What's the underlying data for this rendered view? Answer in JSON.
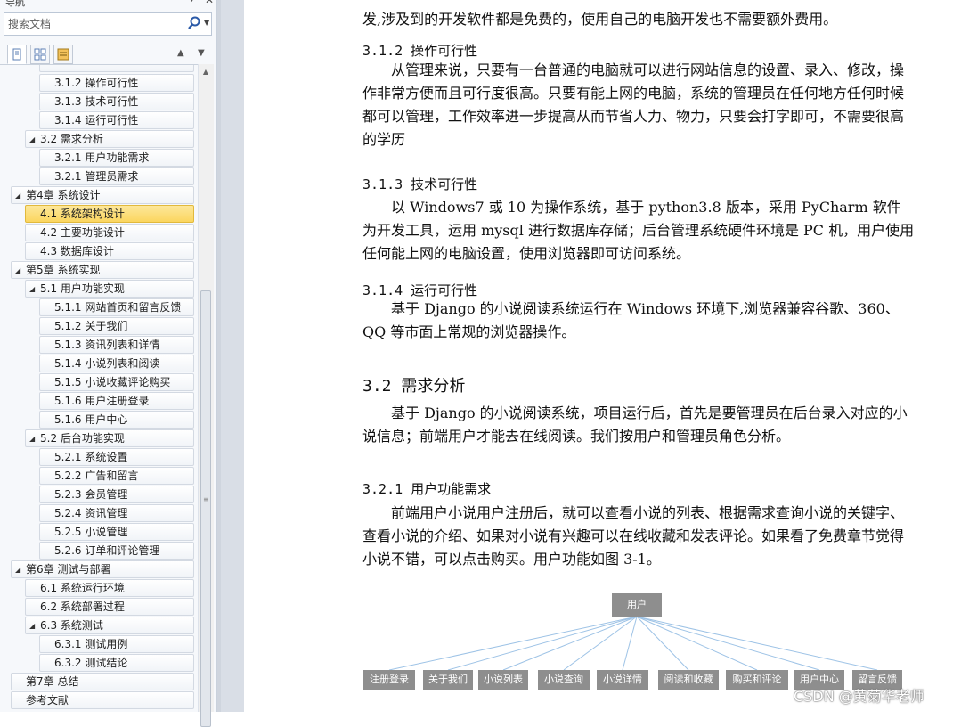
{
  "nav": {
    "title": "导航",
    "search_placeholder": "搜索文档",
    "tree": [
      {
        "label": "3.1.2  操作可行性"
      },
      {
        "label": "3.1.3  技术可行性"
      },
      {
        "label": "3.1.4  运行可行性"
      },
      {
        "label": "3.2  需求分析"
      },
      {
        "label": "3.2.1  用户功能需求"
      },
      {
        "label": "3.2.1  管理员需求"
      },
      {
        "label": "第4章  系统设计"
      },
      {
        "label": "4.1  系统架构设计"
      },
      {
        "label": "4.2  主要功能设计"
      },
      {
        "label": "4.3  数据库设计"
      },
      {
        "label": "第5章  系统实现"
      },
      {
        "label": "5.1  用户功能实现"
      },
      {
        "label": "5.1.1 网站首页和留言反馈"
      },
      {
        "label": "5.1.2 关于我们"
      },
      {
        "label": "5.1.3 资讯列表和详情"
      },
      {
        "label": "5.1.4 小说列表和阅读"
      },
      {
        "label": "5.1.5 小说收藏评论购买"
      },
      {
        "label": "5.1.6 用户注册登录"
      },
      {
        "label": "5.1.6 用户中心"
      },
      {
        "label": "5.2  后台功能实现"
      },
      {
        "label": "5.2.1  系统设置"
      },
      {
        "label": "5.2.2  广告和留言"
      },
      {
        "label": "5.2.3  会员管理"
      },
      {
        "label": "5.2.4  资讯管理"
      },
      {
        "label": "5.2.5  小说管理"
      },
      {
        "label": "5.2.6  订单和评论管理"
      },
      {
        "label": "第6章  测试与部署"
      },
      {
        "label": "6.1  系统运行环境"
      },
      {
        "label": "6.2  系统部署过程"
      },
      {
        "label": "6.3  系统测试"
      },
      {
        "label": "6.3.1  测试用例"
      },
      {
        "label": "6.3.2  测试结论"
      },
      {
        "label": "第7章  总结"
      },
      {
        "label": "参考文献"
      }
    ]
  },
  "doc": {
    "p_top": "发,涉及到的开发软件都是免费的，使用自己的电脑开发也不需要额外费用。",
    "h_312": "3.1.2  操作可行性",
    "p_312": "从管理来说，只要有一台普通的电脑就可以进行网站信息的设置、录入、修改，操作非常方便而且可行度很高。只要有能上网的电脑，系统的管理员在任何地方任何时候都可以管理，工作效率进一步提高从而节省人力、物力，只要会打字即可，不需要很高的学历",
    "h_313": "3.1.3  技术可行性",
    "p_313": "以 Windows7 或 10 为操作系统，基于 python3.8 版本，采用 PyCharm 软件为开发工具，运用 mysql 进行数据库存储；后台管理系统硬件环境是 PC 机，用户使用任何能上网的电脑设置，使用浏览器即可访问系统。",
    "h_314": "3.1.4  运行可行性",
    "p_314": "基于 Django 的小说阅读系统运行在 Windows 环境下,浏览器兼容谷歌、360、QQ 等市面上常规的浏览器操作。",
    "h_32": "3.2  需求分析",
    "p_32": "基于 Django 的小说阅读系统，项目运行后，首先是要管理员在后台录入对应的小说信息；前端用户才能去在线阅读。我们按用户和管理员角色分析。",
    "h_321": "3.2.1  用户功能需求",
    "p_321": "前端用户小说用户注册后，就可以查看小说的列表、根据需求查询小说的关键字、查看小说的介绍、如果对小说有兴趣可以在线收藏和发表评论。如果看了免费章节觉得小说不错，可以点击购买。用户功能如图 3-1。",
    "diagram": {
      "root": "用户",
      "children": [
        "注册登录",
        "关于我们",
        "小说列表",
        "小说查询",
        "小说详情",
        "阅读和收藏",
        "购买和评论",
        "用户中心",
        "留言反馈"
      ]
    }
  },
  "watermark": "CSDN @黄菊华老师",
  "colors": {
    "selected": "#fbd65f",
    "diagram_box": "#8e8e8e",
    "diagram_line": "#9ec3e6"
  }
}
